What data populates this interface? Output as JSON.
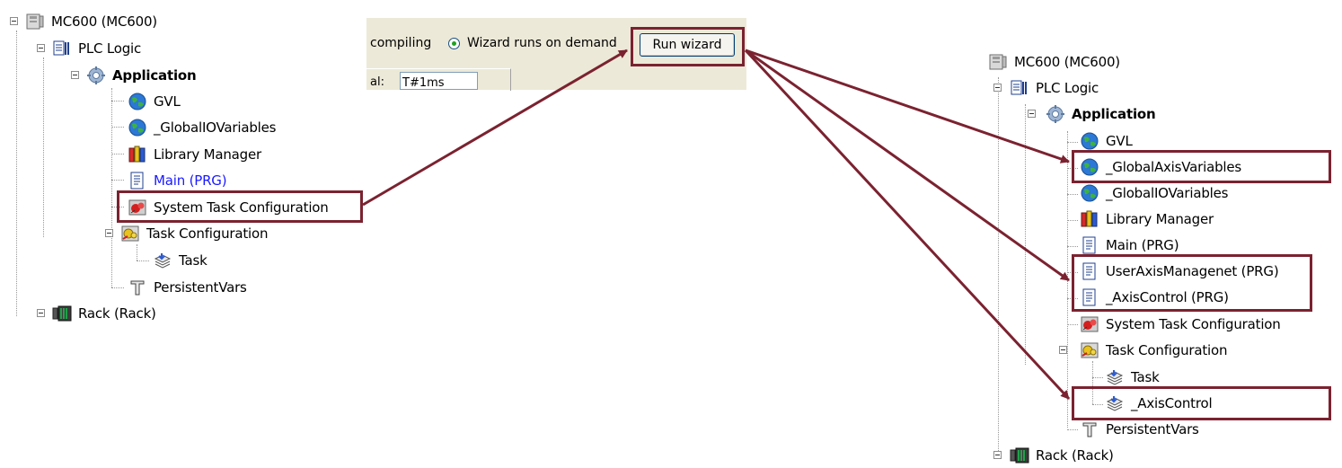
{
  "left_tree": {
    "root": "MC600 (MC600)",
    "plc_logic": "PLC Logic",
    "application": "Application",
    "gvl": "GVL",
    "global_io": "_GlobalIOVariables",
    "library_manager": "Library Manager",
    "main_prg": "Main (PRG)",
    "system_task_config": "System Task Configuration",
    "task_config": "Task Configuration",
    "task": "Task",
    "persistent_vars": "PersistentVars",
    "rack": "Rack (Rack)"
  },
  "toolbar": {
    "compiling_text": "compiling",
    "radio_label": "Wizard runs on demand",
    "run_wizard_label": "Run wizard",
    "partial_label": "al:",
    "partial_value": "T#1ms"
  },
  "right_tree": {
    "root": "MC600 (MC600)",
    "plc_logic": "PLC Logic",
    "application": "Application",
    "gvl": "GVL",
    "global_axis": "_GlobalAxisVariables",
    "global_io": "_GlobalIOVariables",
    "library_manager": "Library Manager",
    "main_prg": "Main (PRG)",
    "user_axis": "UserAxisManagenet (PRG)",
    "axis_control_prg": "_AxisControl (PRG)",
    "system_task_config": "System Task Configuration",
    "task_config": "Task Configuration",
    "task": "Task",
    "axis_control_task": "_AxisControl",
    "persistent_vars": "PersistentVars",
    "rack": "Rack (Rack)"
  },
  "colors": {
    "highlight": "#7b2230",
    "link": "#1a1aff",
    "toolbar_bg": "#ece9d8"
  }
}
